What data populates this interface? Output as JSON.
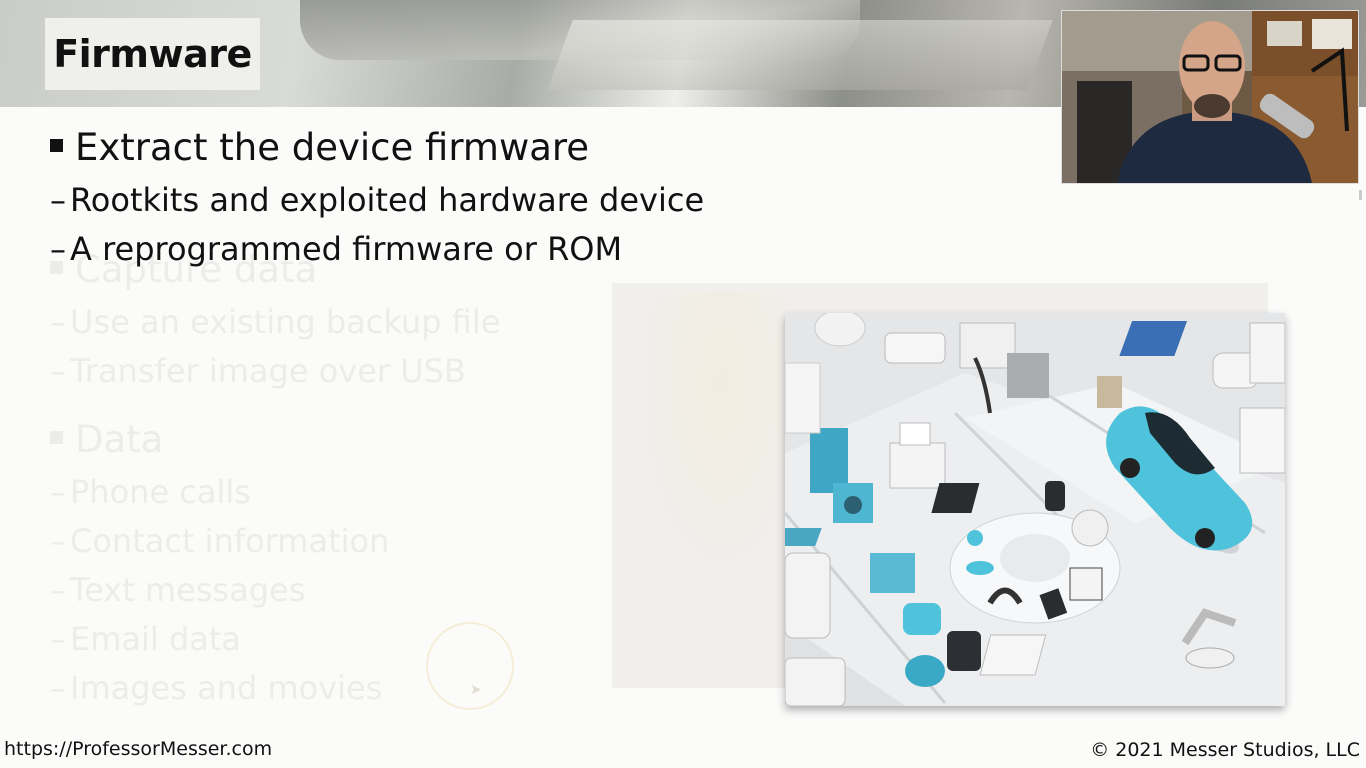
{
  "slide": {
    "title": "Firmware",
    "active_bullets": [
      {
        "level": 1,
        "text": "Extract the device firmware"
      },
      {
        "level": 2,
        "text": "Rootkits and exploited hardware device"
      },
      {
        "level": 2,
        "text": "A reprogrammed firmware or ROM"
      }
    ],
    "faded_bullets": [
      {
        "level": 1,
        "text": "Capture data"
      },
      {
        "level": 2,
        "text": "Use an existing backup file"
      },
      {
        "level": 2,
        "text": "Transfer image over USB"
      },
      {
        "level": 1,
        "text": "Data"
      },
      {
        "level": 2,
        "text": "Phone calls"
      },
      {
        "level": 2,
        "text": "Contact information"
      },
      {
        "level": 2,
        "text": "Text messages"
      },
      {
        "level": 2,
        "text": "Email data"
      },
      {
        "level": 2,
        "text": "Images and movies"
      }
    ],
    "dash_glyph": "–"
  },
  "footer": {
    "left": "https://ProfessorMesser.com",
    "right": "© 2021 Messer Studios, LLC"
  },
  "colors": {
    "text_active": "#111111",
    "text_faded": "#ececea",
    "car": "#4fc3dc"
  }
}
